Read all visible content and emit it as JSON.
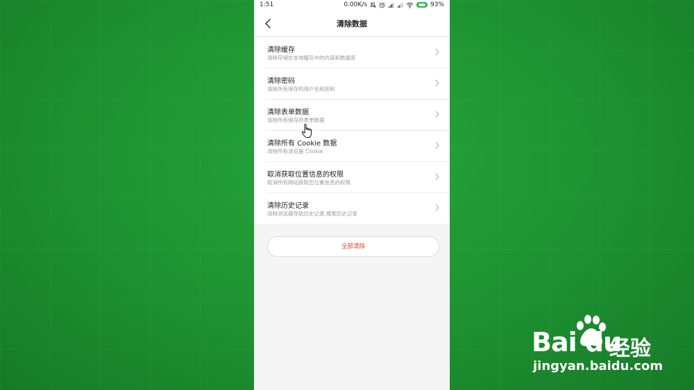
{
  "status_bar": {
    "time": "1:51",
    "network_speed": "0.00K/s",
    "battery_percent": "93%",
    "icons": [
      "mute-bell-icon",
      "alarm-icon",
      "signal-icon",
      "signal-icon",
      "wifi-icon",
      "battery-icon"
    ]
  },
  "header": {
    "title": "清除数据",
    "back_icon": "chevron-left-icon"
  },
  "items": [
    {
      "title": "清除缓存",
      "subtitle": "清除存储在本地缓存中的内容和数据库"
    },
    {
      "title": "清除密码",
      "subtitle": "清除所有保存的用户名和密码"
    },
    {
      "title": "清除表单数据",
      "subtitle": "清除所有保存的表单数据"
    },
    {
      "title": "清除所有 Cookie 数据",
      "subtitle": "清除所有浏览器 Cookie"
    },
    {
      "title": "取消获取位置信息的权限",
      "subtitle": "取消所有网站获取您位置信息的权限"
    },
    {
      "title": "清除历史记录",
      "subtitle": "清除浏览器导航历史记录,搜索历史记录"
    }
  ],
  "clear_all_label": "全部清除",
  "watermark": {
    "logo": "Bai du",
    "logo_cn": "经验",
    "domain": "jingyan.baidu.com"
  },
  "colors": {
    "background": "#1f9733",
    "accent_red": "#d9452b",
    "battery_green": "#27b04a"
  }
}
